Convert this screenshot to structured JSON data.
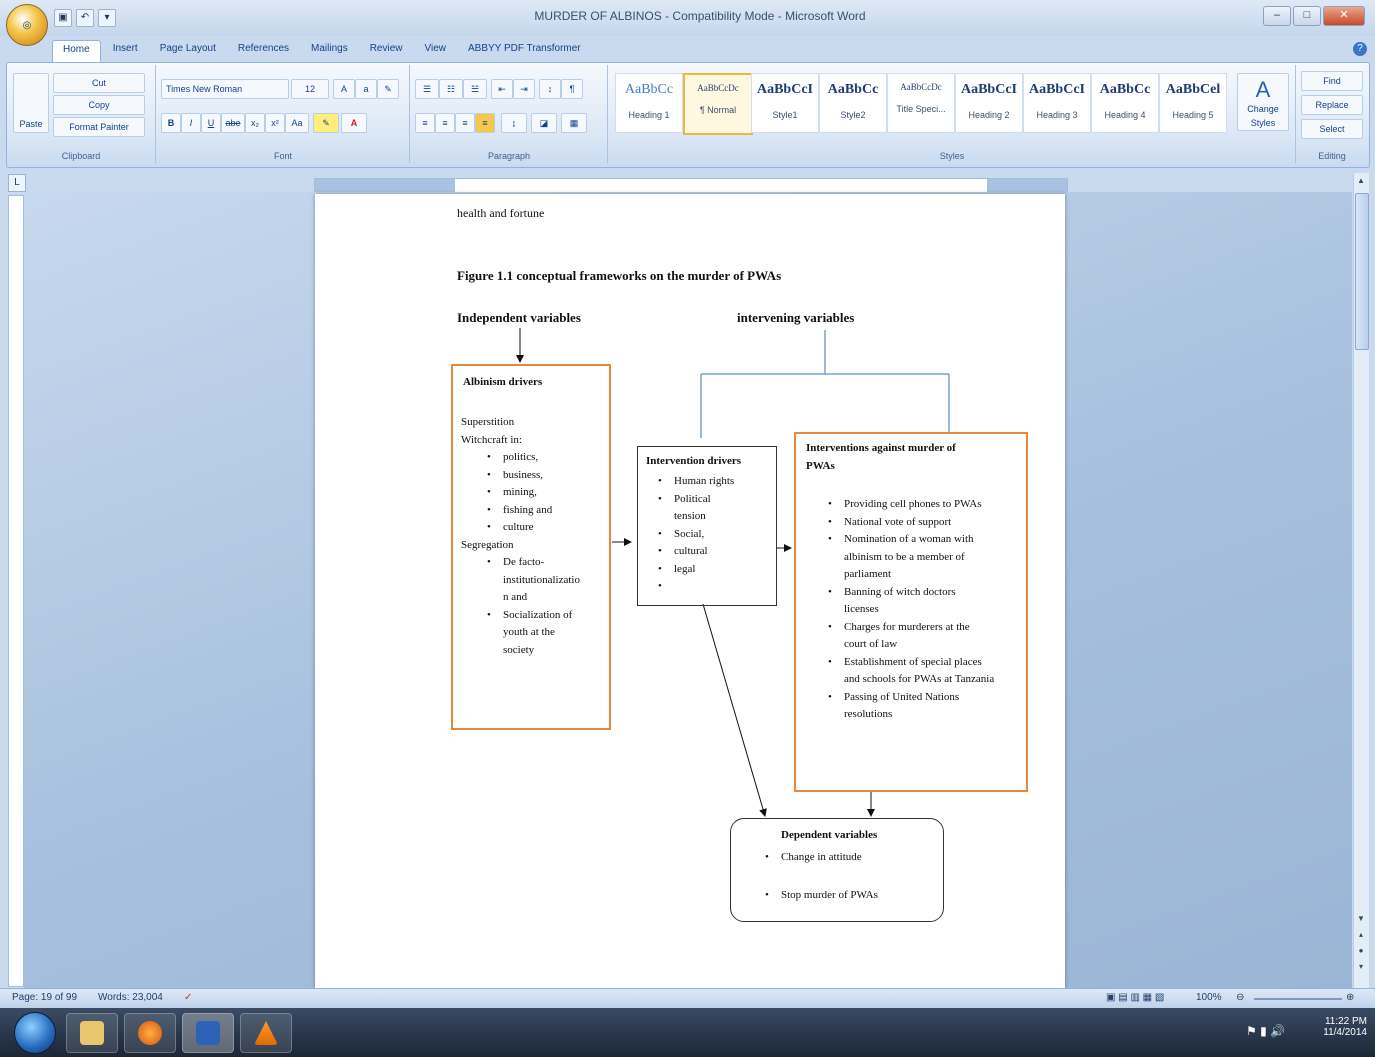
{
  "window": {
    "title": "MURDER OF ALBINOS - Compatibility Mode - Microsoft Word",
    "minimize": "–",
    "maximize": "□",
    "close": "✕"
  },
  "tabs": [
    "Home",
    "Insert",
    "Page Layout",
    "References",
    "Mailings",
    "Review",
    "View",
    "ABBYY PDF Transformer"
  ],
  "ribbon": {
    "clipboard": {
      "paste": "Paste",
      "cut": "Cut",
      "copy": "Copy",
      "format_painter": "Format Painter",
      "label": "Clipboard"
    },
    "font": {
      "name": "Times New Roman",
      "size": "12",
      "label": "Font"
    },
    "paragraph": {
      "label": "Paragraph"
    },
    "styles": {
      "label": "Styles",
      "items": [
        {
          "sample": "AaBbCc",
          "name": "Heading 1"
        },
        {
          "sample": "AaBbCcDc",
          "name": "¶ Normal"
        },
        {
          "sample": "AaBbCcI",
          "name": "Style1"
        },
        {
          "sample": "AaBbCc",
          "name": "Style2"
        },
        {
          "sample": "AaBbCcDc",
          "name": "Title Speci..."
        },
        {
          "sample": "AaBbCcI",
          "name": "Heading 2"
        },
        {
          "sample": "AaBbCcI",
          "name": "Heading 3"
        },
        {
          "sample": "AaBbCc",
          "name": "Heading 4"
        },
        {
          "sample": "AaBbCel",
          "name": "Heading 5"
        }
      ],
      "change_styles": "Change Styles"
    },
    "editing": {
      "find": "Find",
      "replace": "Replace",
      "select": "Select",
      "label": "Editing"
    }
  },
  "document": {
    "line1": "health and fortune",
    "figure_title": "Figure 1.1 conceptual frameworks on the murder of PWAs",
    "independent_label": "Independent variables",
    "intervening_label": "intervening variables",
    "albinism_box": {
      "title": "Albinism drivers",
      "items": [
        {
          "text": "Superstition",
          "bullet": false
        },
        {
          "text": "Witchcraft in:",
          "bullet": false
        },
        {
          "text": "politics,",
          "bullet": true
        },
        {
          "text": "business,",
          "bullet": true
        },
        {
          "text": "mining,",
          "bullet": true
        },
        {
          "text": "fishing and",
          "bullet": true
        },
        {
          "text": "culture",
          "bullet": true
        },
        {
          "text": "Segregation",
          "bullet": false
        },
        {
          "text": "De facto-",
          "bullet": true
        },
        {
          "text": "institutionalizatio",
          "bullet": false
        },
        {
          "text": "n and",
          "bullet": false
        },
        {
          "text": "Socialization of",
          "bullet": true
        },
        {
          "text": "youth at the",
          "bullet": false
        },
        {
          "text": "society",
          "bullet": false
        }
      ]
    },
    "intervention_drivers": {
      "title": "Intervention drivers",
      "items": [
        {
          "text": "Human rights",
          "bullet": true
        },
        {
          "text": "Political",
          "bullet": true
        },
        {
          "text": "tension",
          "bullet": false
        },
        {
          "text": "Social,",
          "bullet": true
        },
        {
          "text": "cultural",
          "bullet": true
        },
        {
          "text": "legal",
          "bullet": true
        },
        {
          "text": "",
          "bullet": true
        }
      ]
    },
    "interventions_box": {
      "title_line1": "Interventions against murder of",
      "title_line2": "PWAs",
      "items": [
        {
          "text": "Providing cell phones to PWAs",
          "bullet": true
        },
        {
          "text": "National vote of support",
          "bullet": true
        },
        {
          "text": "Nomination of a woman with",
          "bullet": true
        },
        {
          "text": "albinism to be a member of",
          "bullet": false
        },
        {
          "text": "parliament",
          "bullet": false
        },
        {
          "text": "Banning of witch doctors",
          "bullet": true
        },
        {
          "text": "licenses",
          "bullet": false
        },
        {
          "text": "Charges for murderers at the",
          "bullet": true
        },
        {
          "text": "court of law",
          "bullet": false
        },
        {
          "text": "Establishment of special places",
          "bullet": true
        },
        {
          "text": "and schools for PWAs at Tanzania",
          "bullet": false
        },
        {
          "text": "Passing of United Nations",
          "bullet": true
        },
        {
          "text": "resolutions",
          "bullet": false
        }
      ]
    },
    "dependent_box": {
      "title": "Dependent variables",
      "item1": "Change in attitude",
      "item2": "Stop murder of PWAs"
    }
  },
  "status": {
    "page": "Page: 19 of 99",
    "words": "Words: 23,004",
    "zoom": "100%"
  },
  "taskbar": {
    "time": "11:22 PM",
    "date": "11/4/2014"
  }
}
